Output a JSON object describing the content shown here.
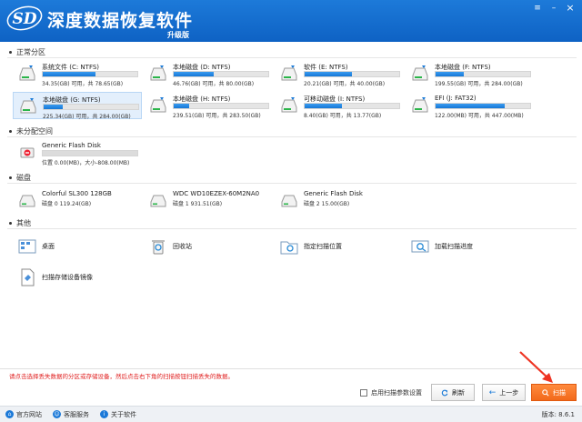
{
  "app": {
    "logo_text": "SD",
    "title": "深度数据恢复软件",
    "edition": "升级版"
  },
  "window_buttons": {
    "menu": "≡",
    "minimize": "–",
    "close": "×"
  },
  "sections": {
    "normal": "正常分区",
    "unallocated": "未分配空间",
    "disks": "磁盘",
    "other": "其他"
  },
  "partitions": [
    {
      "name": "系统文件 (C: NTFS)",
      "info": "34.35(GB) 可用，共 78.65(GB)",
      "used_fraction": 0.56
    },
    {
      "name": "本地磁盘 (D: NTFS)",
      "info": "46.76(GB) 可用，共 80.00(GB)",
      "used_fraction": 0.42
    },
    {
      "name": "软件 (E: NTFS)",
      "info": "20.21(GB) 可用，共 40.00(GB)",
      "used_fraction": 0.5
    },
    {
      "name": "本地磁盘 (F: NTFS)",
      "info": "199.55(GB) 可用，共 284.00(GB)",
      "used_fraction": 0.3
    },
    {
      "name": "本地磁盘 (G: NTFS)",
      "info": "225.34(GB) 可用，共 284.00(GB)",
      "used_fraction": 0.2
    },
    {
      "name": "本地磁盘 (H: NTFS)",
      "info": "239.51(GB) 可用，共 283.50(GB)",
      "used_fraction": 0.16
    },
    {
      "name": "可移动磁盘 (I: NTFS)",
      "info": "8.40(GB) 可用，共 13.77(GB)",
      "used_fraction": 0.39
    },
    {
      "name": "EFI (J: FAT32)",
      "info": "122.00(MB) 可用，共 447.00(MB)",
      "used_fraction": 0.73
    }
  ],
  "unallocated": {
    "name": "Generic Flash Disk",
    "info": "位置 0.00(MB)，大小-808.00(MB)"
  },
  "disks": [
    {
      "name": "Colorful SL300 128GB",
      "info": "磁盘 0     119.24(GB)"
    },
    {
      "name": "WDC WD10EZEX-60M2NA0",
      "info": "磁盘 1     931.51(GB)"
    },
    {
      "name": "Generic Flash Disk",
      "info": "磁盘 2     15.00(GB)"
    }
  ],
  "others": [
    {
      "name": "桌面"
    },
    {
      "name": "回收站"
    },
    {
      "name": "指定扫描位置"
    },
    {
      "name": "加载扫描进度"
    },
    {
      "name": "扫描存储设备镜像"
    }
  ],
  "status_message": "请点击选择丢失数据的分区或存储设备，然后点击右下角的扫描按钮扫描丢失的数据。",
  "footer": {
    "checkbox_label": "启用扫描参数设置",
    "refresh": "刷新",
    "prev": "上一步",
    "scan": "扫描"
  },
  "bottombar": {
    "website": "官方网站",
    "support": "客服服务",
    "about": "关于软件",
    "version": "版本: 8.6.1"
  },
  "colors": {
    "titlebar": "#1572d3",
    "accent": "#1577d6",
    "scan_button": "#f26a1b",
    "status_text": "#e02020"
  }
}
